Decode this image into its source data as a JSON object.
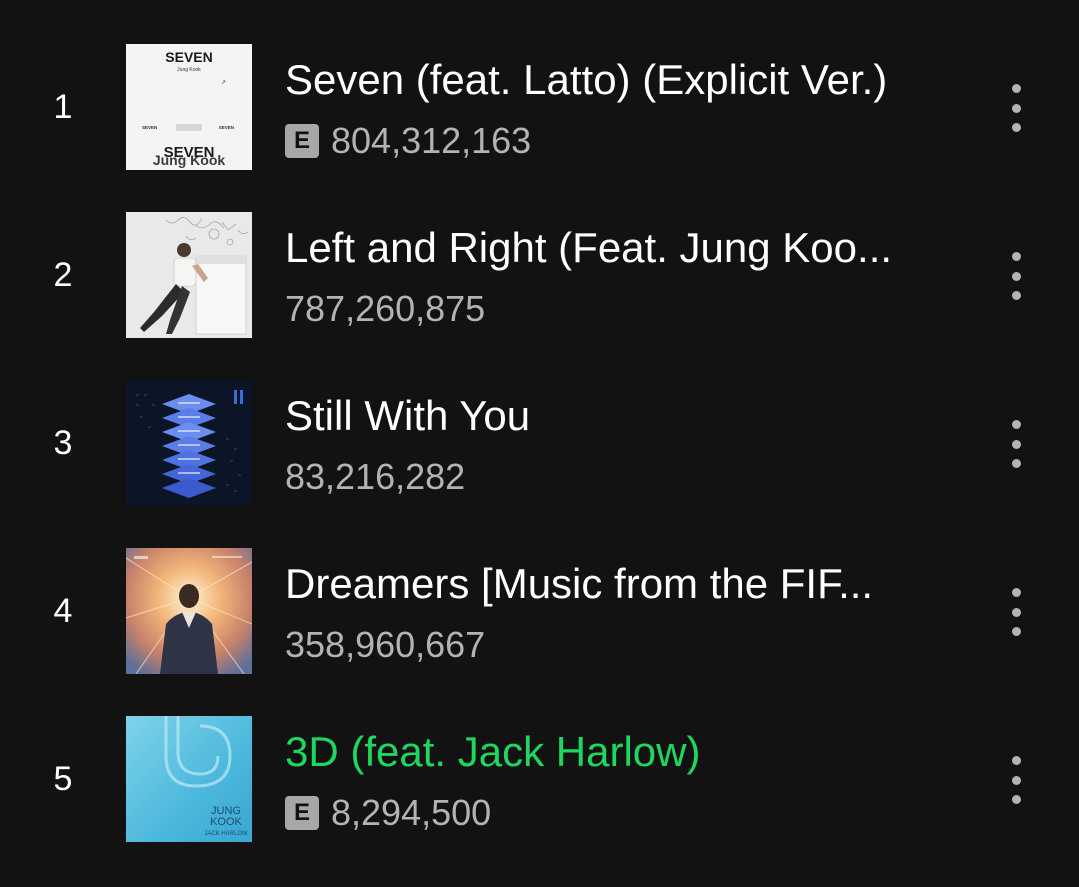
{
  "colors": {
    "background": "#121212",
    "text_primary": "#ffffff",
    "text_secondary": "#b3b3b3",
    "now_playing": "#1ed760",
    "explicit_badge": "#a7a7a7"
  },
  "explicit_label": "E",
  "tracks": [
    {
      "rank": "1",
      "title": "Seven (feat. Latto) (Explicit Ver.)",
      "explicit": true,
      "plays": "804,312,163",
      "cover_texts": {
        "title": "SEVEN",
        "artist": "Jung Kook",
        "logo": "SEVEN",
        "logo_sub": "Jung Kook",
        "small_left": "SEVEN",
        "small_right": "SEVEN"
      },
      "more_icon": "more-options-icon"
    },
    {
      "rank": "2",
      "title": "Left and Right (Feat. Jung Koo...",
      "explicit": false,
      "plays": "787,260,875",
      "more_icon": "more-options-icon"
    },
    {
      "rank": "3",
      "title": "Still With You",
      "explicit": false,
      "plays": "83,216,282",
      "more_icon": "more-options-icon"
    },
    {
      "rank": "4",
      "title": "Dreamers [Music from the FIF...",
      "explicit": false,
      "plays": "358,960,667",
      "more_icon": "more-options-icon"
    },
    {
      "rank": "5",
      "title": "3D (feat. Jack Harlow)",
      "explicit": true,
      "plays": "8,294,500",
      "now_playing": true,
      "cover_texts": {
        "line1": "JUNG",
        "line2": "KOOK",
        "line3": "JACK HARLOW"
      },
      "more_icon": "more-options-icon"
    }
  ]
}
